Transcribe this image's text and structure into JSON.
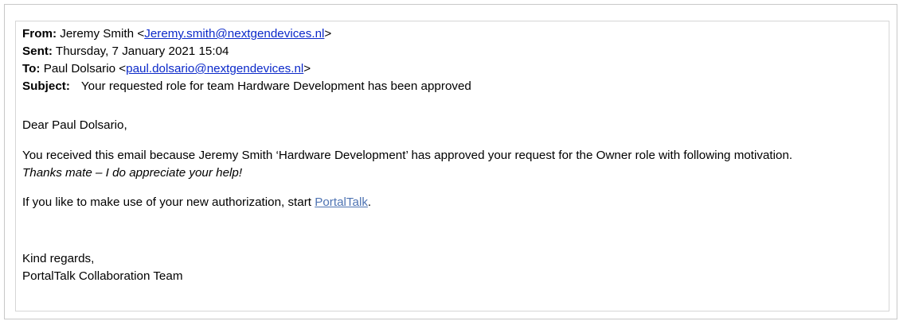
{
  "header": {
    "from_label": "From:",
    "from_name": "Jeremy Smith",
    "from_email": "Jeremy.smith@nextgendevices.nl",
    "sent_label": "Sent:",
    "sent_value": "Thursday, 7 January 2021 15:04",
    "to_label": "To:",
    "to_name": "Paul Dolsario",
    "to_email": "paul.dolsario@nextgendevices.nl",
    "subject_label": "Subject:",
    "subject_value": "Your requested role for team Hardware Development has been approved"
  },
  "body": {
    "greeting": "Dear Paul Dolsario,",
    "paragraph1": "You received this email because Jeremy Smith  ‘Hardware Development’ has approved your request for the Owner role with following motivation.",
    "motivation": "Thanks mate – I do appreciate your help!",
    "paragraph2_prefix": "If you like to make use of your new authorization, start",
    "paragraph2_link": "PortalTalk",
    "paragraph2_suffix": ".",
    "closing_line1": "Kind regards,",
    "closing_line2": "PortalTalk Collaboration Team"
  },
  "colors": {
    "email_link": "#0b29c9",
    "portal_link": "#4f74b3",
    "frame_border": "#c8c8c8"
  }
}
